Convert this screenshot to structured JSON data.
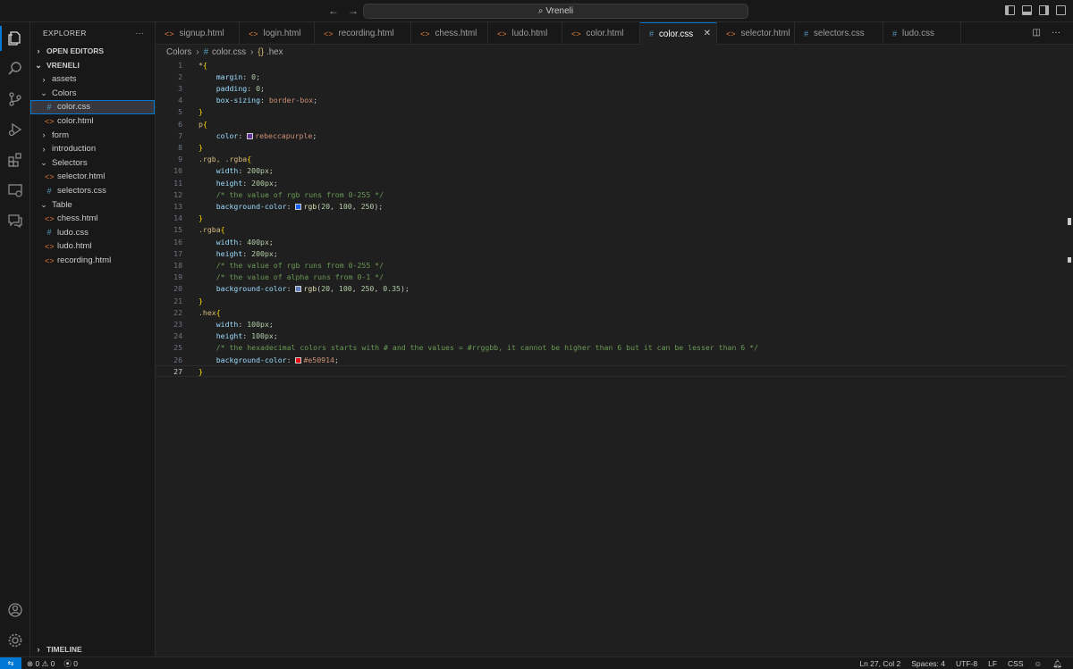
{
  "window": {
    "title": "Vreneli"
  },
  "colors": {
    "accent": "#0078d4",
    "background": "#1f1f1f",
    "sidebar": "#181818",
    "selector": "#d7ba7d",
    "property": "#9cdcfe",
    "comment": "#6a9955"
  },
  "activity_icons": [
    "explorer-icon",
    "search-icon",
    "source-control-icon",
    "run-debug-icon",
    "extensions-icon",
    "remote-explorer-icon",
    "chat-icon",
    "account-icon",
    "manage-gear-icon"
  ],
  "sidebar": {
    "title": "EXPLORER",
    "open_editors": "OPEN EDITORS",
    "project": "VRENELI",
    "timeline": "TIMELINE",
    "tree": [
      {
        "label": "assets",
        "type": "folder",
        "open": false,
        "depth": 1
      },
      {
        "label": "Colors",
        "type": "folder",
        "open": true,
        "depth": 1
      },
      {
        "label": "color.css",
        "type": "css",
        "depth": 2,
        "selected": true
      },
      {
        "label": "color.html",
        "type": "html",
        "depth": 2
      },
      {
        "label": "form",
        "type": "folder",
        "open": false,
        "depth": 1
      },
      {
        "label": "introduction",
        "type": "folder",
        "open": false,
        "depth": 1
      },
      {
        "label": "Selectors",
        "type": "folder",
        "open": true,
        "depth": 1
      },
      {
        "label": "selector.html",
        "type": "html",
        "depth": 2
      },
      {
        "label": "selectors.css",
        "type": "css",
        "depth": 2
      },
      {
        "label": "Table",
        "type": "folder",
        "open": true,
        "depth": 1
      },
      {
        "label": "chess.html",
        "type": "html",
        "depth": 2
      },
      {
        "label": "ludo.css",
        "type": "css",
        "depth": 2
      },
      {
        "label": "ludo.html",
        "type": "html",
        "depth": 2
      },
      {
        "label": "recording.html",
        "type": "html",
        "depth": 2
      }
    ]
  },
  "tabs": [
    {
      "label": "signup.html",
      "type": "html"
    },
    {
      "label": "login.html",
      "type": "html"
    },
    {
      "label": "recording.html",
      "type": "html"
    },
    {
      "label": "chess.html",
      "type": "html"
    },
    {
      "label": "ludo.html",
      "type": "html"
    },
    {
      "label": "color.html",
      "type": "html"
    },
    {
      "label": "color.css",
      "type": "css",
      "active": true
    },
    {
      "label": "selector.html",
      "type": "html"
    },
    {
      "label": "selectors.css",
      "type": "css"
    },
    {
      "label": "ludo.css",
      "type": "css"
    }
  ],
  "breadcrumb": {
    "folder": "Colors",
    "file": "color.css",
    "symbol": ".hex"
  },
  "code": [
    [
      [
        "sel",
        "*"
      ],
      [
        "brace",
        "{"
      ]
    ],
    [
      [
        "i",
        ""
      ],
      [
        "prop",
        "margin"
      ],
      [
        "plain",
        ": "
      ],
      [
        "num",
        "0"
      ],
      [
        "plain",
        ";"
      ]
    ],
    [
      [
        "i",
        ""
      ],
      [
        "prop",
        "padding"
      ],
      [
        "plain",
        ": "
      ],
      [
        "num",
        "0"
      ],
      [
        "plain",
        ";"
      ]
    ],
    [
      [
        "i",
        ""
      ],
      [
        "prop",
        "box-sizing"
      ],
      [
        "plain",
        ": "
      ],
      [
        "val",
        "border-box"
      ],
      [
        "plain",
        ";"
      ]
    ],
    [
      [
        "brace",
        "}"
      ]
    ],
    [
      [
        "sel",
        "p"
      ],
      [
        "brace",
        "{"
      ]
    ],
    [
      [
        "i",
        ""
      ],
      [
        "prop",
        "color"
      ],
      [
        "plain",
        ": "
      ],
      [
        "sw",
        "#663399"
      ],
      [
        "val",
        "rebeccapurple"
      ],
      [
        "plain",
        ";"
      ]
    ],
    [
      [
        "brace",
        "}"
      ]
    ],
    [
      [
        "sel",
        ".rgb, .rgba"
      ],
      [
        "brace",
        "{"
      ]
    ],
    [
      [
        "i",
        ""
      ],
      [
        "prop",
        "width"
      ],
      [
        "plain",
        ": "
      ],
      [
        "num",
        "200px"
      ],
      [
        "plain",
        ";"
      ]
    ],
    [
      [
        "i",
        ""
      ],
      [
        "prop",
        "height"
      ],
      [
        "plain",
        ": "
      ],
      [
        "num",
        "200px"
      ],
      [
        "plain",
        ";"
      ]
    ],
    [
      [
        "i",
        ""
      ],
      [
        "cmt",
        "/* the value of rgb runs from 0-255 */"
      ]
    ],
    [
      [
        "i",
        ""
      ],
      [
        "prop",
        "background-color"
      ],
      [
        "plain",
        ": "
      ],
      [
        "sw",
        "#1464fa"
      ],
      [
        "fn",
        "rgb"
      ],
      [
        "plain",
        "("
      ],
      [
        "num",
        "20"
      ],
      [
        "plain",
        ", "
      ],
      [
        "num",
        "100"
      ],
      [
        "plain",
        ", "
      ],
      [
        "num",
        "250"
      ],
      [
        "plain",
        ");"
      ]
    ],
    [
      [
        "brace",
        "}"
      ]
    ],
    [
      [
        "sel",
        ".rgba"
      ],
      [
        "brace",
        "{"
      ]
    ],
    [
      [
        "i",
        ""
      ],
      [
        "prop",
        "width"
      ],
      [
        "plain",
        ": "
      ],
      [
        "num",
        "400px"
      ],
      [
        "plain",
        ";"
      ]
    ],
    [
      [
        "i",
        ""
      ],
      [
        "prop",
        "height"
      ],
      [
        "plain",
        ": "
      ],
      [
        "num",
        "200px"
      ],
      [
        "plain",
        ";"
      ]
    ],
    [
      [
        "i",
        ""
      ],
      [
        "cmt",
        "/* the value of rgb runs from 0-255 */"
      ]
    ],
    [
      [
        "i",
        ""
      ],
      [
        "cmt",
        "/* the value of alpha runs from 0-1 */"
      ]
    ],
    [
      [
        "i",
        ""
      ],
      [
        "prop",
        "background-color"
      ],
      [
        "plain",
        ": "
      ],
      [
        "sw",
        "#5f7fbd"
      ],
      [
        "fn",
        "rgb"
      ],
      [
        "plain",
        "("
      ],
      [
        "num",
        "20"
      ],
      [
        "plain",
        ", "
      ],
      [
        "num",
        "100"
      ],
      [
        "plain",
        ", "
      ],
      [
        "num",
        "250"
      ],
      [
        "plain",
        ", "
      ],
      [
        "num",
        "0.35"
      ],
      [
        "plain",
        ");"
      ]
    ],
    [
      [
        "brace",
        "}"
      ]
    ],
    [
      [
        "sel",
        ".hex"
      ],
      [
        "brace",
        "{"
      ]
    ],
    [
      [
        "i",
        ""
      ],
      [
        "prop",
        "width"
      ],
      [
        "plain",
        ": "
      ],
      [
        "num",
        "100px"
      ],
      [
        "plain",
        ";"
      ]
    ],
    [
      [
        "i",
        ""
      ],
      [
        "prop",
        "height"
      ],
      [
        "plain",
        ": "
      ],
      [
        "num",
        "100px"
      ],
      [
        "plain",
        ";"
      ]
    ],
    [
      [
        "i",
        ""
      ],
      [
        "cmt",
        "/* the hexadecimal colors starts with # and the values = #rrggbb, it cannot be higher than 6 but it can be lesser than 6 */"
      ]
    ],
    [
      [
        "i",
        ""
      ],
      [
        "prop",
        "background-color"
      ],
      [
        "plain",
        ": "
      ],
      [
        "sw",
        "#e50914"
      ],
      [
        "val",
        "#e50914"
      ],
      [
        "plain",
        ";"
      ]
    ],
    [
      [
        "brace",
        "}"
      ]
    ]
  ],
  "current_line": 27,
  "status": {
    "errors": "0",
    "warnings": "0",
    "ports": "0",
    "position": "Ln 27, Col 2",
    "spaces": "Spaces: 4",
    "encoding": "UTF-8",
    "eol": "LF",
    "language": "CSS"
  }
}
